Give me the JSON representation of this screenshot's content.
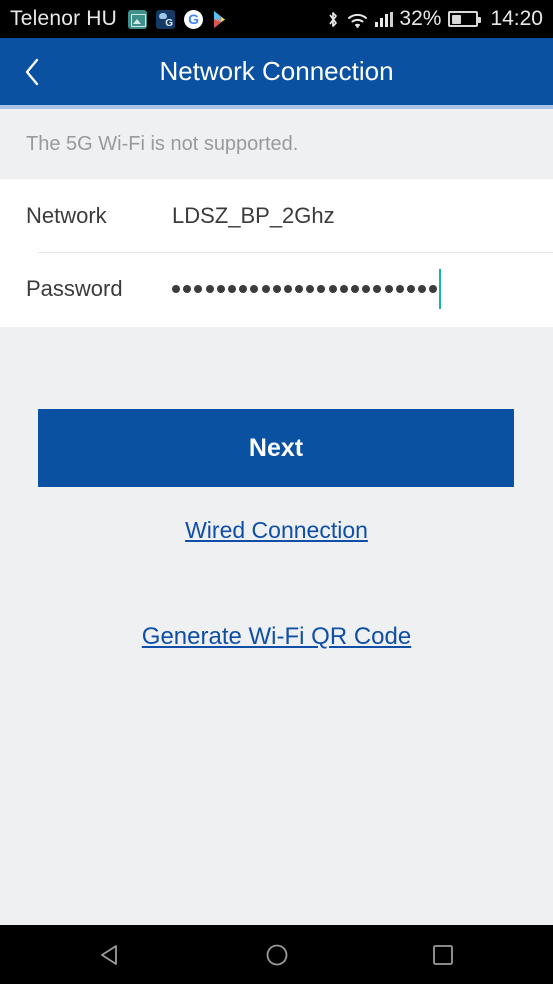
{
  "status_bar": {
    "carrier": "Telenor HU",
    "notification_icons": [
      "photo-icon",
      "weather-google-icon",
      "google-icon",
      "play-store-icon"
    ],
    "bluetooth_icon": "bluetooth-icon",
    "wifi_icon": "wifi-icon",
    "cellular_icon": "cellular-signal-icon",
    "battery_percent": "32%",
    "battery_icon": "battery-icon",
    "clock": "14:20"
  },
  "app_bar": {
    "back_icon": "back-chevron-icon",
    "title": "Network Connection",
    "bg_color": "#0a51a1",
    "accent_strip_color": "#a8c3e6"
  },
  "notice": {
    "text": "The 5G Wi-Fi is not supported."
  },
  "form": {
    "network": {
      "label": "Network",
      "value": "LDSZ_BP_2Ghz"
    },
    "password": {
      "label": "Password",
      "masked_value": "••••••••••••••••••••••••",
      "dot_count": 24,
      "caret_color": "#16b5b0",
      "clear_icon": "clear-circle-x-icon",
      "visibility_icon": "eye-closed-icon",
      "visibility_state": "hidden"
    }
  },
  "actions": {
    "next_label": "Next",
    "next_bg_color": "#0a51a1",
    "wired_link": "Wired Connection",
    "qr_link": "Generate Wi-Fi QR Code",
    "link_color": "#0f4fa8"
  },
  "nav_bar": {
    "back_icon": "nav-back-triangle-icon",
    "home_icon": "nav-home-circle-icon",
    "recents_icon": "nav-recents-square-icon"
  }
}
